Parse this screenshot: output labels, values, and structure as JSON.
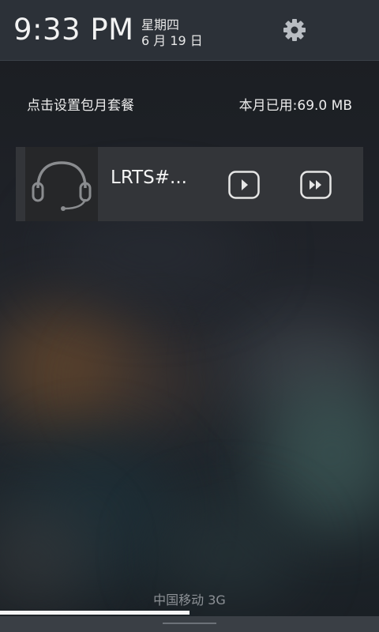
{
  "status": {
    "time": "9:33 PM",
    "day": "星期四",
    "date": "6 月 19 日",
    "settings_icon": "gear-icon"
  },
  "data_usage": {
    "plan_link": "点击设置包月套餐",
    "usage": "本月已用:69.0 MB"
  },
  "media": {
    "album_icon": "headset-icon",
    "title": "LRTS#...",
    "play_icon": "play-icon",
    "next_icon": "fast-forward-icon"
  },
  "footer": {
    "carrier": "中国移动 3G"
  },
  "colors": {
    "header_bg": "#2c3138",
    "card_bg": "#333539",
    "text": "#ececec"
  }
}
